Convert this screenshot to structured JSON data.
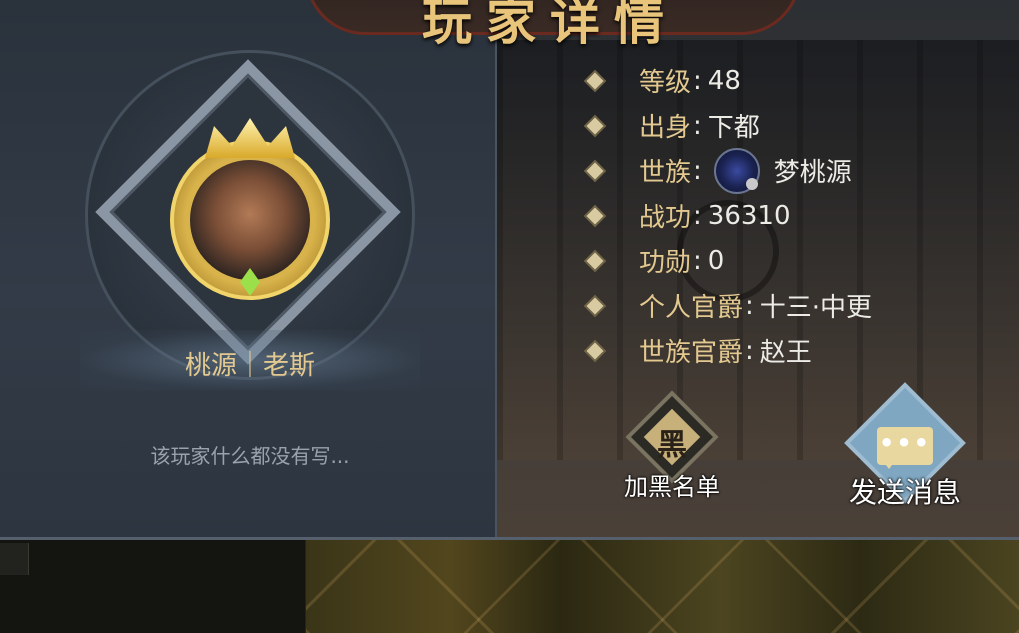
{
  "title": "玩家详情",
  "player": {
    "name": "桃源｜老斯",
    "signature": "该玩家什么都没有写..."
  },
  "info": [
    {
      "label": "等级",
      "value": "48"
    },
    {
      "label": "出身",
      "value": "下都"
    },
    {
      "label": "世族",
      "value": "梦桃源",
      "icon": "clan-emblem"
    },
    {
      "label": "战功",
      "value": "36310"
    },
    {
      "label": "功勋",
      "value": "0"
    },
    {
      "label": "个人官爵",
      "value": "十三·中更"
    },
    {
      "label": "世族官爵",
      "value": "赵王"
    }
  ],
  "actions": {
    "blacklist": {
      "glyph": "黑",
      "label": "加黑名单"
    },
    "message": {
      "glyph": "•••",
      "label": "发送消息"
    }
  },
  "colors": {
    "gold_text": "#e3c990",
    "panel": "#2a3038"
  }
}
